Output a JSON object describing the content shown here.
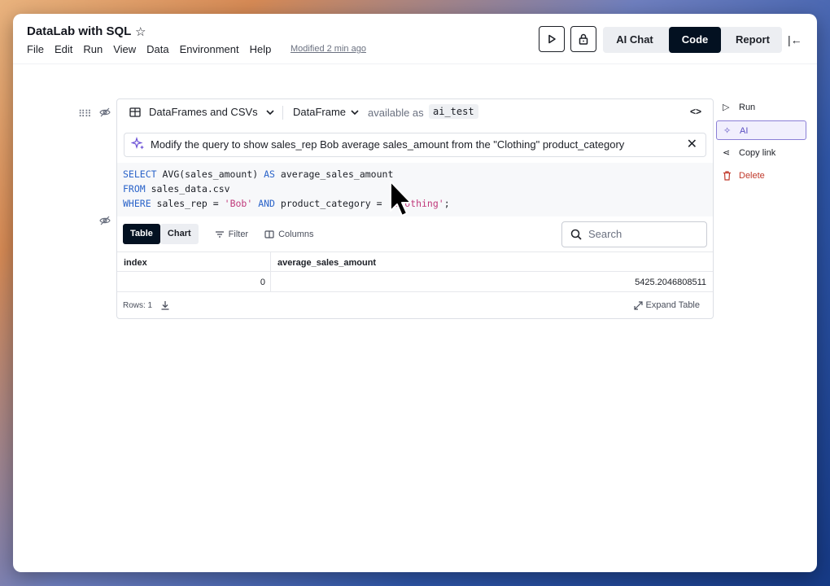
{
  "app": {
    "title": "DataLab with SQL",
    "menu": [
      "File",
      "Edit",
      "Run",
      "View",
      "Data",
      "Environment",
      "Help"
    ],
    "modified": "Modified 2 min ago"
  },
  "header": {
    "modes": [
      "AI Chat",
      "Code",
      "Report"
    ],
    "active_mode": "Code"
  },
  "cell": {
    "source_label": "DataFrames and CSVs",
    "output_type": "DataFrame",
    "available_as": "available as",
    "variable": "ai_test",
    "ai_prompt": "Modify the query to show sales_rep Bob average sales_amount from the \"Clothing\" product_category",
    "code": {
      "line1_kw": "SELECT",
      "line1_rest": " AVG(sales_amount) ",
      "line1_kw2": "AS",
      "line1_end": " average_sales_amount",
      "line2_kw": "FROM",
      "line2_rest": " sales_data.csv",
      "line3_kw": "WHERE",
      "line3_a": " sales_rep = ",
      "line3_str1": "'Bob'",
      "line3_kw2": " AND",
      "line3_b": " product_category = ",
      "line3_str2": "'Clothing'",
      "line3_end": ";"
    }
  },
  "output": {
    "tabs": [
      "Table",
      "Chart"
    ],
    "filter_label": "Filter",
    "columns_label": "Columns",
    "search_placeholder": "Search",
    "headers": [
      "index",
      "average_sales_amount"
    ],
    "rows": [
      [
        "0",
        "5425.2046808511"
      ]
    ],
    "rows_count": "Rows: 1",
    "expand_label": "Expand Table"
  },
  "side_menu": {
    "run": "Run",
    "ai": "AI",
    "copy_link": "Copy link",
    "delete": "Delete"
  }
}
